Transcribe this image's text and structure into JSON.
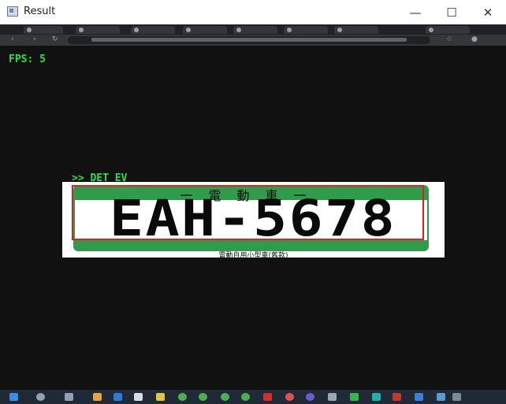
{
  "window": {
    "title": "Result",
    "minimize": "—",
    "maximize": "☐",
    "close": "✕"
  },
  "overlay": {
    "fps_text": "FPS: 5",
    "det_text": ">> DET EV"
  },
  "plate": {
    "header": "一電動車一",
    "number": "EAH-5678",
    "caption": "電動自用小型車(舊款)"
  },
  "colors": {
    "overlay_green": "#26e04a",
    "box_red": "#e02020",
    "plate_green": "#2e9c4a"
  },
  "icons": [
    "windows-start-icon",
    "search-icon",
    "task-view-icon",
    "app-icon"
  ]
}
